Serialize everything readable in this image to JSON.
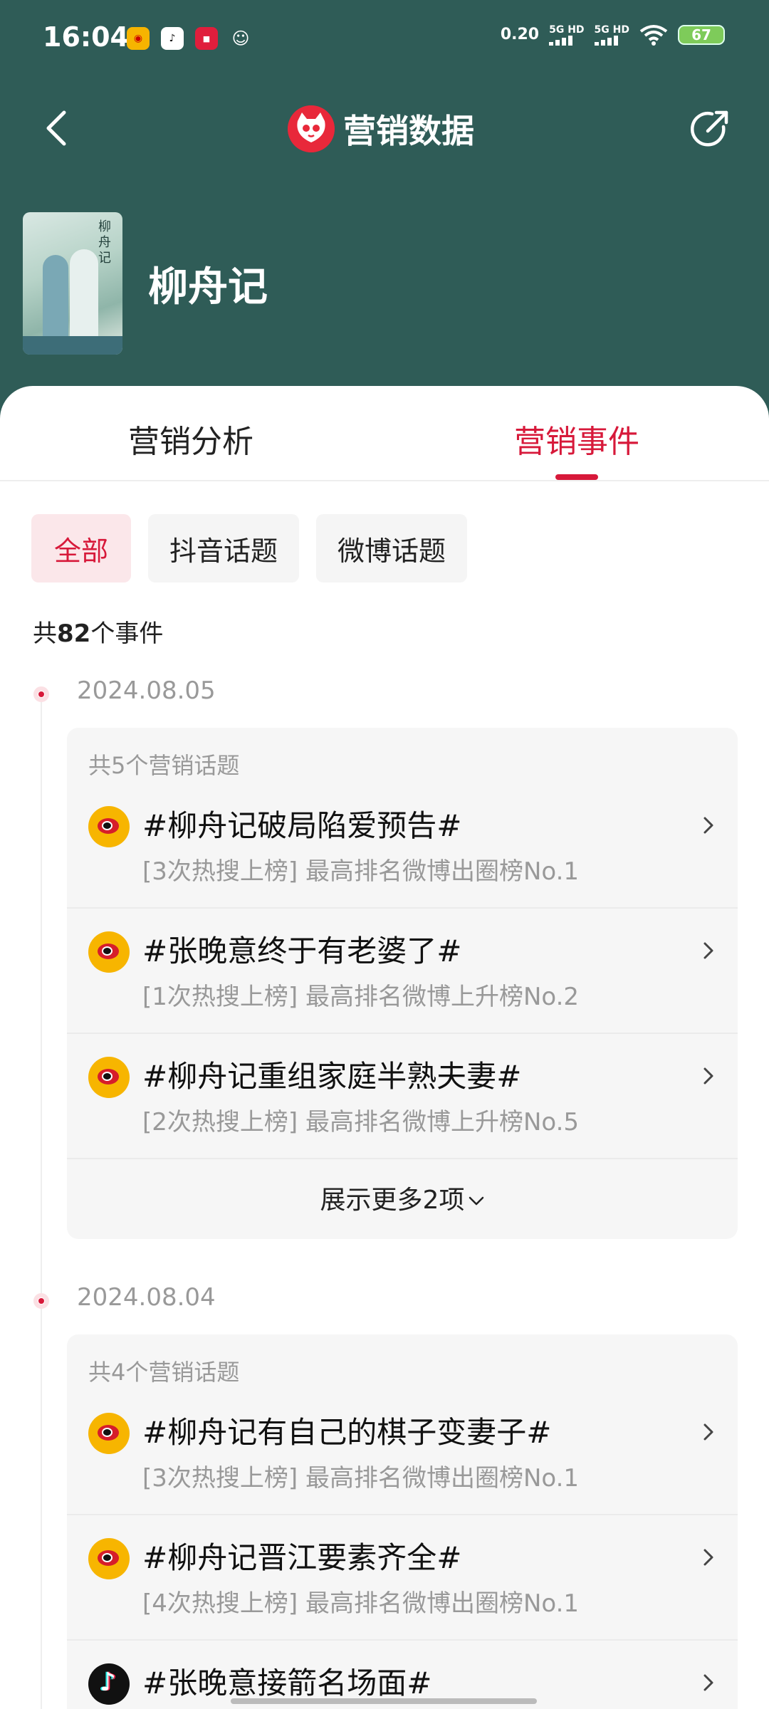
{
  "status_bar": {
    "time": "16:04",
    "apps": [
      "weibo-icon",
      "tiktok-icon",
      "red-app-icon",
      "cat-app-icon"
    ],
    "net_speed": "0.20",
    "sim1": "5G HD",
    "sim2": "5G HD",
    "battery": "67"
  },
  "nav": {
    "title": "营销数据",
    "back_icon": "chevron-left-icon",
    "share_icon": "share-icon"
  },
  "drama": {
    "title": "柳舟记",
    "poster_text": "柳舟记"
  },
  "tabs": [
    {
      "label": "营销分析",
      "active": false
    },
    {
      "label": "营销事件",
      "active": true
    }
  ],
  "filters": [
    {
      "label": "全部",
      "active": true
    },
    {
      "label": "抖音话题",
      "active": false
    },
    {
      "label": "微博话题",
      "active": false
    }
  ],
  "total": {
    "prefix": "共",
    "count": "82",
    "suffix": "个事件"
  },
  "groups": [
    {
      "date": "2024.08.05",
      "count_label": "共5个营销话题",
      "topics": [
        {
          "platform": "weibo",
          "title": "#柳舟记破局陷爱预告#",
          "meta": "[3次热搜上榜] 最高排名微博出圈榜No.1"
        },
        {
          "platform": "weibo",
          "title": "#张晚意终于有老婆了#",
          "meta": "[1次热搜上榜] 最高排名微博上升榜No.2"
        },
        {
          "platform": "weibo",
          "title": "#柳舟记重组家庭半熟夫妻#",
          "meta": "[2次热搜上榜] 最高排名微博上升榜No.5"
        }
      ],
      "show_more": "展示更多2项"
    },
    {
      "date": "2024.08.04",
      "count_label": "共4个营销话题",
      "topics": [
        {
          "platform": "weibo",
          "title": "#柳舟记有自己的棋子变妻子#",
          "meta": "[3次热搜上榜] 最高排名微博出圈榜No.1"
        },
        {
          "platform": "weibo",
          "title": "#柳舟记晋江要素齐全#",
          "meta": "[4次热搜上榜] 最高排名微博出圈榜No.1"
        },
        {
          "platform": "douyin",
          "title": "#张晚意接箭名场面#",
          "meta": ""
        }
      ]
    }
  ],
  "colors": {
    "header_bg": "#2f5c57",
    "accent": "#d7193a",
    "chip_active_bg": "#fbe7ea"
  }
}
